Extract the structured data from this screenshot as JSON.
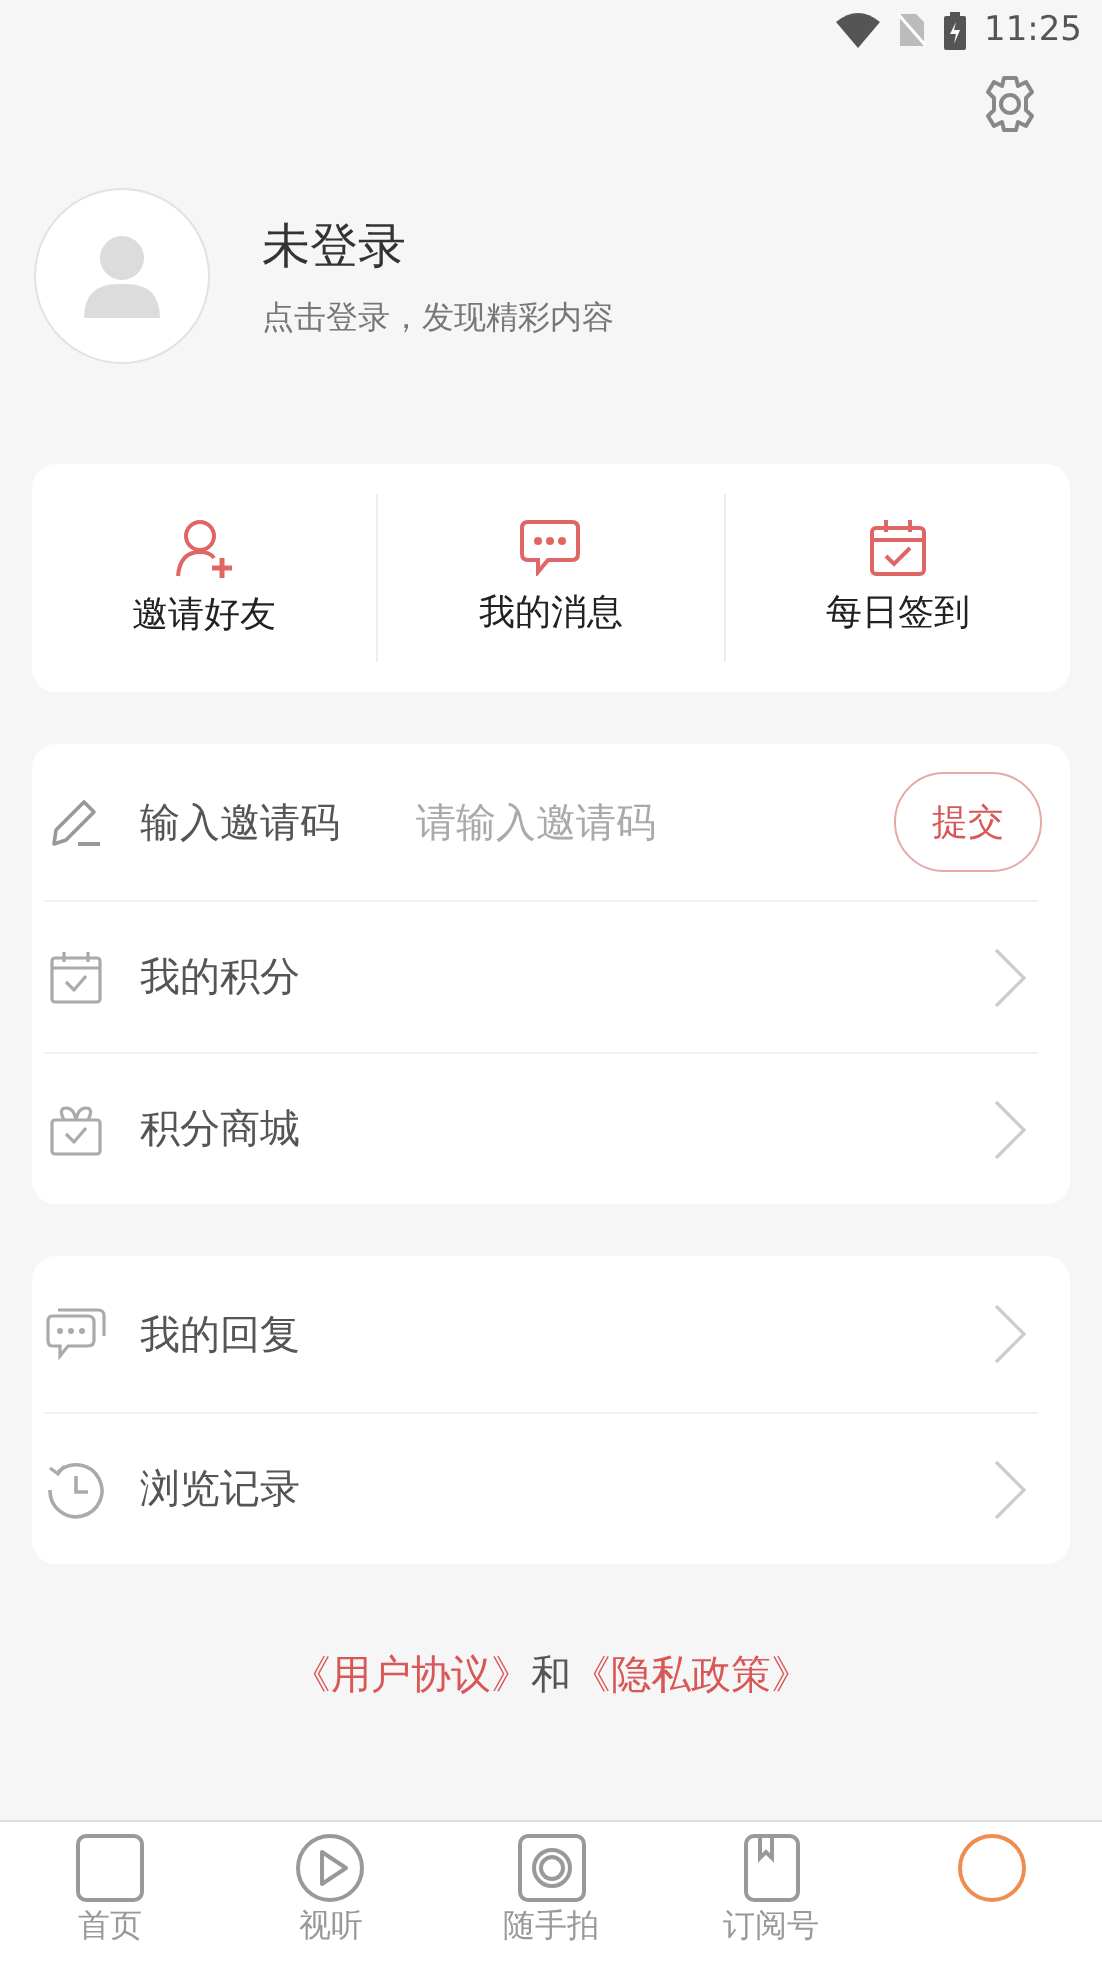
{
  "status_bar": {
    "time": "11:25"
  },
  "profile": {
    "name": "未登录",
    "hint": "点击登录，发现精彩内容"
  },
  "shortcuts": [
    {
      "label": "邀请好友"
    },
    {
      "label": "我的消息"
    },
    {
      "label": "每日签到"
    }
  ],
  "menu_groups": [
    {
      "rows": [
        {
          "kind": "invite",
          "label": "输入邀请码",
          "placeholder": "请输入邀请码",
          "button": "提交"
        },
        {
          "kind": "link",
          "label": "我的积分"
        },
        {
          "kind": "link",
          "label": "积分商城"
        }
      ]
    },
    {
      "rows": [
        {
          "kind": "link",
          "label": "我的回复"
        },
        {
          "kind": "link",
          "label": "浏览记录"
        }
      ]
    }
  ],
  "agreement": {
    "user_agreement": "《用户协议》",
    "conjunction": "和",
    "privacy_policy": "《隐私政策》"
  },
  "tab_bar": [
    {
      "label": "首页",
      "selected": false
    },
    {
      "label": "视听",
      "selected": false
    },
    {
      "label": "随手拍",
      "selected": false
    },
    {
      "label": "订阅号",
      "selected": false
    },
    {
      "selected": true
    }
  ]
}
